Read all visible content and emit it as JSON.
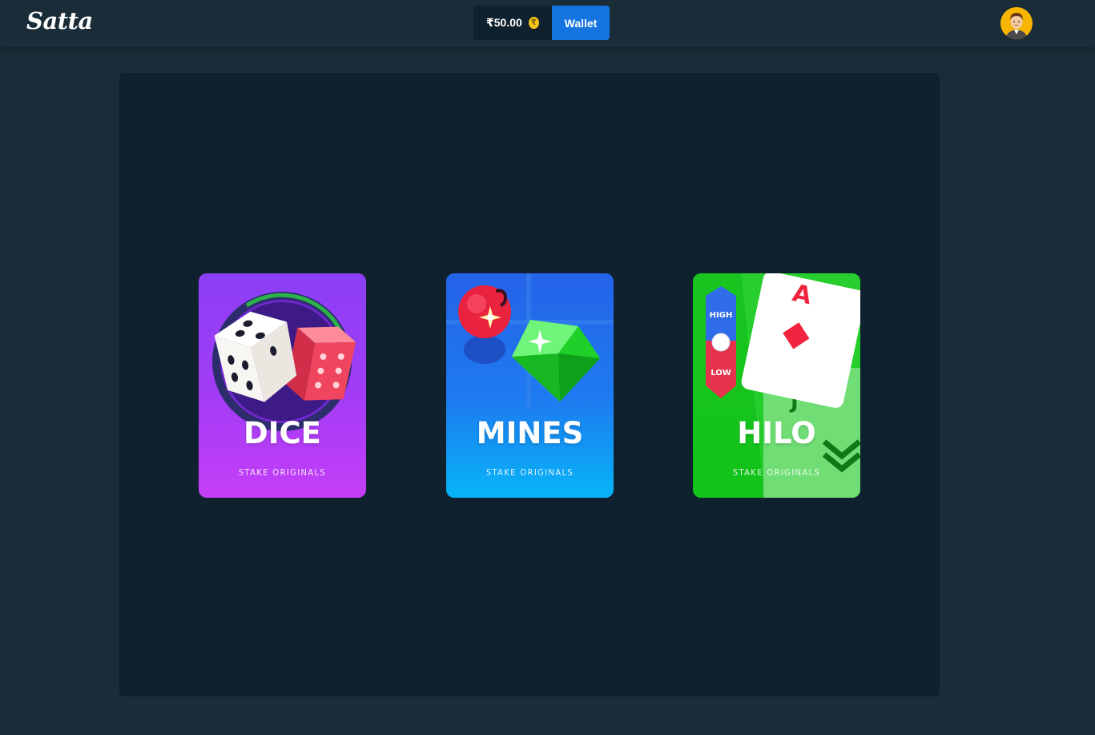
{
  "header": {
    "logo": "Satta",
    "balance": "₹50.00",
    "coin_symbol": "₹",
    "wallet_label": "Wallet"
  },
  "games": [
    {
      "title": "DICE",
      "subtitle": "STAKE ORIGINALS",
      "color": "#a33cf6"
    },
    {
      "title": "MINES",
      "subtitle": "STAKE ORIGINALS",
      "color": "#1e7af0"
    },
    {
      "title": "HILO",
      "subtitle": "STAKE ORIGINALS",
      "color": "#12c31a"
    }
  ],
  "hilo_art": {
    "high_label": "HIGH",
    "low_label": "LOW",
    "card_top": "A",
    "card_back": "J"
  },
  "colors": {
    "background": "#1a2c38",
    "panel": "#0f212e",
    "accent": "#1475e1",
    "coin": "#f5c518"
  }
}
